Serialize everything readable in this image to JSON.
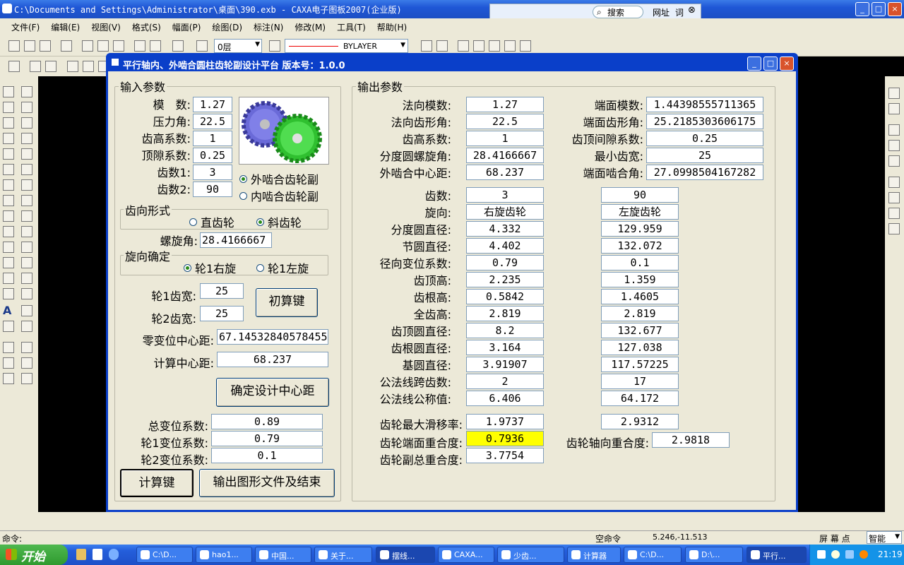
{
  "app": {
    "title": "C:\\Documents and Settings\\Administrator\\桌面\\390.exb - CAXA电子图板2007(企业版)"
  },
  "search": {
    "button": "搜索",
    "site": "网址",
    "word": "词"
  },
  "menu": [
    "文件(F)",
    "编辑(E)",
    "视图(V)",
    "格式(S)",
    "幅面(P)",
    "绘图(D)",
    "标注(N)",
    "修改(M)",
    "工具(T)",
    "帮助(H)"
  ],
  "toolbar": {
    "layer": "0层",
    "linetype": "BYLAYER"
  },
  "dialog": {
    "title": "平行轴内、外啮合圆柱齿轮副设计平台 版本号：1.0.0",
    "input": {
      "group": "输入参数",
      "module_label": "模　数:",
      "module": "1.27",
      "pressure_label": "压力角:",
      "pressure": "22.5",
      "addendum_label": "齿高系数:",
      "addendum": "1",
      "clearance_label": "顶隙系数:",
      "clearance": "0.25",
      "z1_label": "齿数1:",
      "z1": "3",
      "z2_label": "齿数2:",
      "z2": "90",
      "ext_mesh": "外啮合齿轮副",
      "int_mesh": "内啮合齿轮副",
      "tooth_form_group": "齿向形式",
      "spur": "直齿轮",
      "helical": "斜齿轮",
      "helix_label": "螺旋角:",
      "helix": "28.4166667",
      "hand_group": "旋向确定",
      "right": "轮1右旋",
      "left": "轮1左旋",
      "b1_label": "轮1齿宽:",
      "b1": "25",
      "b2_label": "轮2齿宽:",
      "b2": "25",
      "init_button": "初算键",
      "zero_center_label": "零变位中心距:",
      "zero_center": "67.14532840578455",
      "calc_center_label": "计算中心距:",
      "calc_center": "68.237",
      "confirm_button": "确定设计中心距",
      "sum_shift_label": "总变位系数:",
      "sum_shift": "0.89",
      "shift1_label": "轮1变位系数:",
      "shift1": "0.79",
      "shift2_label": "轮2变位系数:",
      "shift2": "0.1",
      "calc_button": "计算键",
      "output_button": "输出图形文件及结束"
    },
    "output": {
      "group": "输出参数",
      "top_left": [
        {
          "label": "法向模数:",
          "value": "1.27"
        },
        {
          "label": "法向齿形角:",
          "value": "22.5"
        },
        {
          "label": "齿高系数:",
          "value": "1"
        },
        {
          "label": "分度圆螺旋角:",
          "value": "28.4166667"
        },
        {
          "label": "外啮合中心距:",
          "value": "68.237"
        }
      ],
      "top_right": [
        {
          "label": "端面模数:",
          "value": "1.44398555711365"
        },
        {
          "label": "端面齿形角:",
          "value": "25.2185303606175"
        },
        {
          "label": "齿顶间隙系数:",
          "value": "0.25"
        },
        {
          "label": "最小齿宽:",
          "value": "25"
        },
        {
          "label": "端面啮合角:",
          "value": "27.0998504167282"
        }
      ],
      "rows": [
        {
          "label": "齿数:",
          "g1": "3",
          "g2": "90"
        },
        {
          "label": "旋向:",
          "g1": "右旋齿轮",
          "g2": "左旋齿轮"
        },
        {
          "label": "分度圆直径:",
          "g1": "4.332",
          "g2": "129.959"
        },
        {
          "label": "节圆直径:",
          "g1": "4.402",
          "g2": "132.072"
        },
        {
          "label": "径向变位系数:",
          "g1": "0.79",
          "g2": "0.1"
        },
        {
          "label": "齿顶高:",
          "g1": "2.235",
          "g2": "1.359"
        },
        {
          "label": "齿根高:",
          "g1": "0.5842",
          "g2": "1.4605"
        },
        {
          "label": "全齿高:",
          "g1": "2.819",
          "g2": "2.819"
        },
        {
          "label": "齿顶圆直径:",
          "g1": "8.2",
          "g2": "132.677"
        },
        {
          "label": "齿根圆直径:",
          "g1": "3.164",
          "g2": "127.038"
        },
        {
          "label": "基圆直径:",
          "g1": "3.91907",
          "g2": "117.57225"
        },
        {
          "label": "公法线跨齿数:",
          "g1": "2",
          "g2": "17"
        },
        {
          "label": "公法线公称值:",
          "g1": "6.406",
          "g2": "64.172"
        }
      ],
      "slip_label": "齿轮最大滑移率:",
      "slip1": "1.9737",
      "slip2": "2.9312",
      "transverse_label": "齿轮端面重合度:",
      "transverse": "0.7936",
      "axial_label": "齿轮轴向重合度:",
      "axial": "2.9818",
      "total_label": "齿轮副总重合度:",
      "total": "3.7754"
    }
  },
  "command": {
    "label": "命令:"
  },
  "status": {
    "mode": "空命令",
    "coords": "5.246,-11.513",
    "snap_label": "屏 幕 点",
    "snap": "智能"
  },
  "taskbar": {
    "start": "开始",
    "tasks": [
      "C:\\D...",
      "hao1...",
      "中国...",
      "关于...",
      "摆线...",
      "CAXA...",
      "少齿...",
      "计算器",
      "C:\\D...",
      "D:\\...",
      "平行..."
    ],
    "clock": "21:19"
  }
}
